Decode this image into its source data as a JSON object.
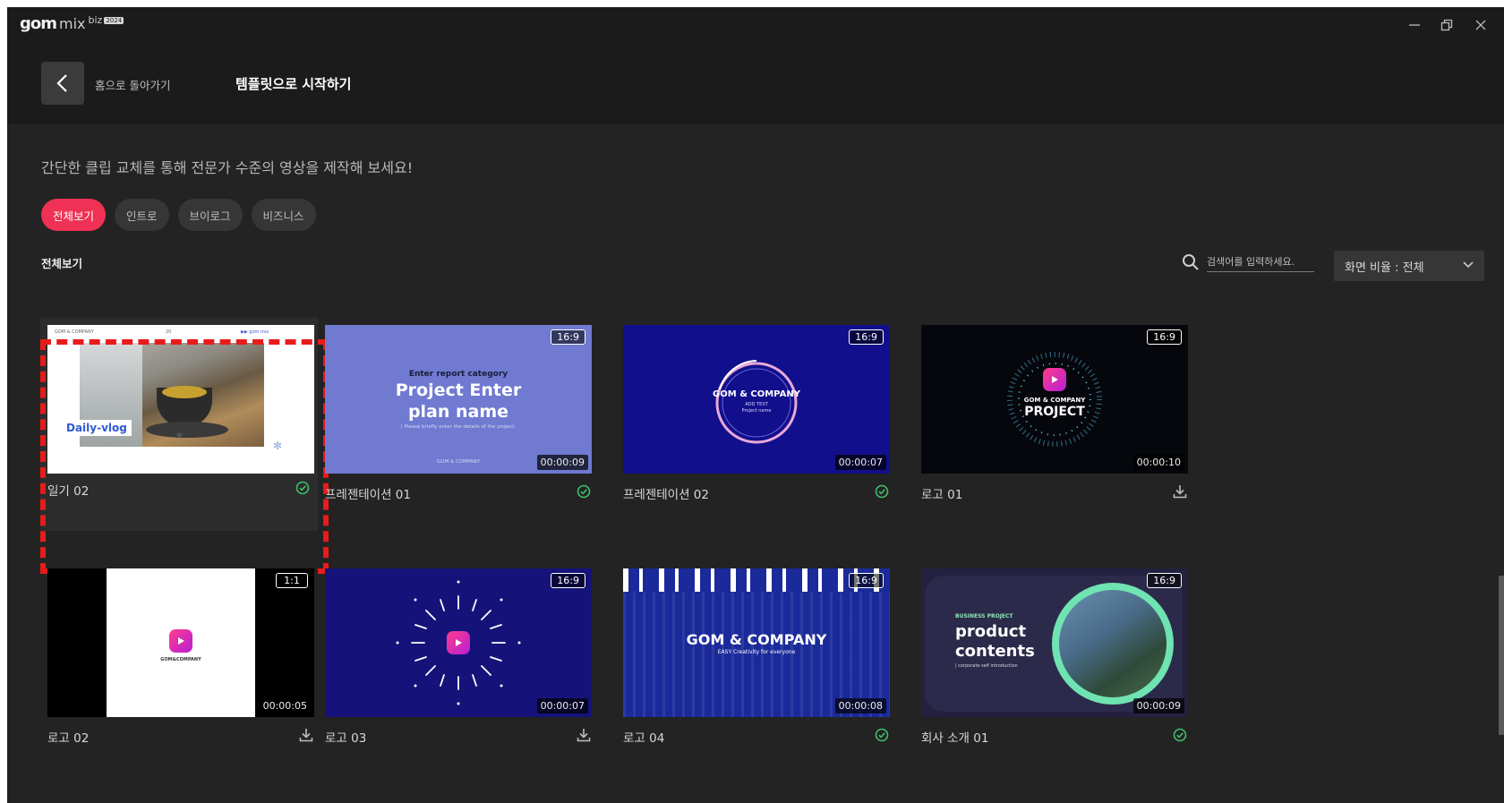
{
  "app": {
    "logo_main": "gom",
    "logo_mix": "mix",
    "logo_biz": "biz",
    "logo_badge": "2024"
  },
  "header": {
    "back_label": "홈으로 돌아가기",
    "title": "템플릿으로 시작하기"
  },
  "subtitle": "간단한 클립 교체를 통해 전문가 수준의 영상을 제작해 보세요!",
  "categories": [
    {
      "label": "전체보기",
      "active": true
    },
    {
      "label": "인트로",
      "active": false
    },
    {
      "label": "브이로그",
      "active": false
    },
    {
      "label": "비즈니스",
      "active": false
    }
  ],
  "section_label": "전체보기",
  "search": {
    "placeholder": "검색어를 입력하세요."
  },
  "ratio_filter": {
    "label": "화면 비율 : 전체"
  },
  "colors": {
    "accent": "#ee3154",
    "check": "#3fbf6a",
    "selection": "#e81b1b"
  },
  "templates": [
    {
      "title": "일기 02",
      "ratio": "",
      "duration": "",
      "status": "check-circle-icon",
      "thumb": {
        "brand": "GOM & COMPANY",
        "number": "20",
        "mark": "▶▶ gom mix",
        "caption": "Daily-vlog"
      }
    },
    {
      "title": "프레젠테이션 01",
      "ratio": "16:9",
      "duration": "00:00:09",
      "status": "check-circle-icon",
      "thumb": {
        "line1": "Enter report category",
        "line2": "Project Enter",
        "line3": "plan name",
        "line4": "| Please briefly enter the details of the project.",
        "footer": "GOM & COMPANY"
      }
    },
    {
      "title": "프레젠테이션 02",
      "ratio": "16:9",
      "duration": "00:00:07",
      "status": "check-circle-icon",
      "thumb": {
        "line1": "GOM & COMPANY",
        "line2": "ADD TEXT",
        "line3": "Project name"
      }
    },
    {
      "title": "로고 01",
      "ratio": "16:9",
      "duration": "00:00:10",
      "status": "download-icon",
      "thumb": {
        "line1": "GOM & COMPANY",
        "line2": "PROJECT"
      }
    },
    {
      "title": "로고 02",
      "ratio": "1:1",
      "duration": "00:00:05",
      "status": "download-icon",
      "thumb": {
        "line1": "GOM&COMPANY"
      }
    },
    {
      "title": "로고 03",
      "ratio": "16:9",
      "duration": "00:00:07",
      "status": "download-icon",
      "thumb": {}
    },
    {
      "title": "로고 04",
      "ratio": "16:9",
      "duration": "00:00:08",
      "status": "check-circle-icon",
      "thumb": {
        "line1": "GOM & COMPANY",
        "line2": "EASY Creativity for everyone"
      }
    },
    {
      "title": "회사 소개 01",
      "ratio": "16:9",
      "duration": "00:00:09",
      "status": "check-circle-icon",
      "thumb": {
        "line1": "BUSINESS PROJECT",
        "line2": "product",
        "line3": "contents",
        "line4": "| corporate self introduction"
      }
    }
  ]
}
